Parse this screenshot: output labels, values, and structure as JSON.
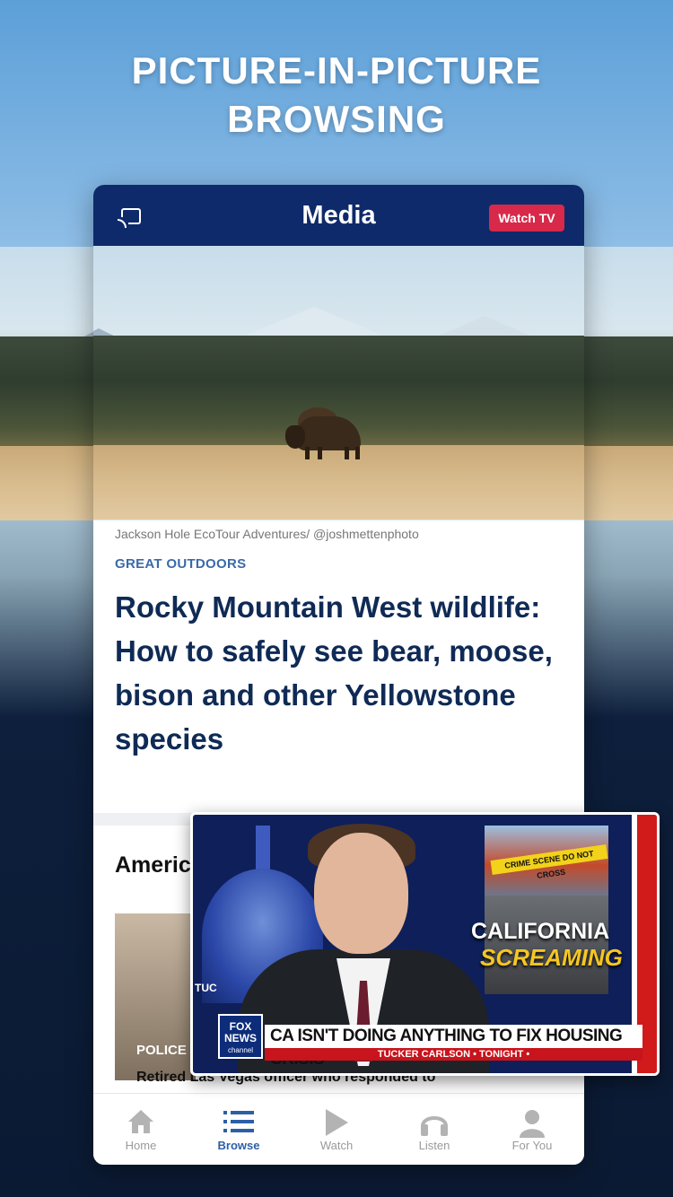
{
  "promo": {
    "line1": "PICTURE-IN-PICTURE",
    "line2": "BROWSING"
  },
  "header": {
    "title": "Media",
    "watch_tv": "Watch TV"
  },
  "article": {
    "photo_credit": "Jackson Hole EcoTour Adventures/ @joshmettenphoto",
    "kicker": "GREAT OUTDOORS",
    "headline": "Rocky Mountain West wildlife: How to safely see bear, moose, bison and other Yellowstone species"
  },
  "next_section": {
    "title": "Americ",
    "thumb_label": "POLICE",
    "story_line": "Retired Las Vegas officer who responded to"
  },
  "tabs": [
    {
      "label": "Home",
      "icon": "home-icon"
    },
    {
      "label": "Browse",
      "icon": "list-icon"
    },
    {
      "label": "Watch",
      "icon": "play-icon"
    },
    {
      "label": "Listen",
      "icon": "headphones-icon"
    },
    {
      "label": "For You",
      "icon": "person-icon"
    }
  ],
  "active_tab": "Browse",
  "pip": {
    "inset_tape": "CRIME SCENE DO NOT CROSS",
    "graphic_line1": "CALIFORNIA",
    "graphic_line2": "SCREAMING",
    "side_text": "TUC",
    "logo_line1": "FOX",
    "logo_line2": "NEWS",
    "logo_line3": "channel",
    "chyron": "CA ISN'T DOING ANYTHING TO FIX HOUSING CRISIS",
    "program": "TUCKER CARLSON • TONIGHT •"
  },
  "colors": {
    "header_blue": "#0f2a6b",
    "watch_tv_red": "#d8294a",
    "headline_navy": "#0f2a55",
    "kicker_blue": "#3b6aa8",
    "active_tab": "#2d5fa6"
  }
}
